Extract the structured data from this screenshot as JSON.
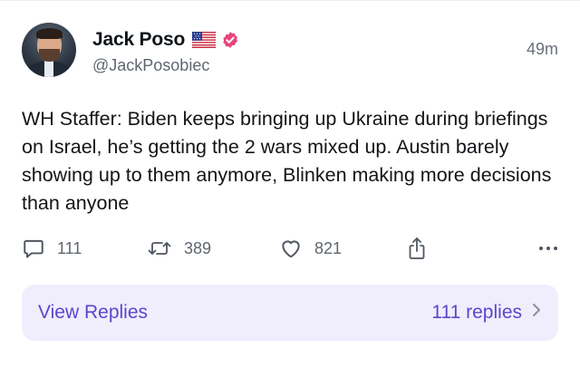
{
  "post": {
    "author_name": "Jack Poso",
    "flag_icon": "us-flag-icon",
    "verified_icon": "verified-badge-icon",
    "verified_color": "#e8457a",
    "handle": "@JackPosobiec",
    "timestamp": "49m",
    "text": "WH Staffer: Biden keeps bringing up Ukraine during briefings on Israel, he’s getting the 2 wars mixed up. Austin barely showing up to them anymore, Blinken making more decisions than anyone"
  },
  "actions": {
    "reply_count": "111",
    "repost_count": "389",
    "like_count": "821",
    "icons": [
      "comment-icon",
      "repost-icon",
      "heart-icon",
      "share-icon",
      "more-icon"
    ]
  },
  "replies_bar": {
    "label": "View Replies",
    "count_label": "111 replies",
    "accent_color": "#5b47c9",
    "background_color": "#f0edfd"
  }
}
